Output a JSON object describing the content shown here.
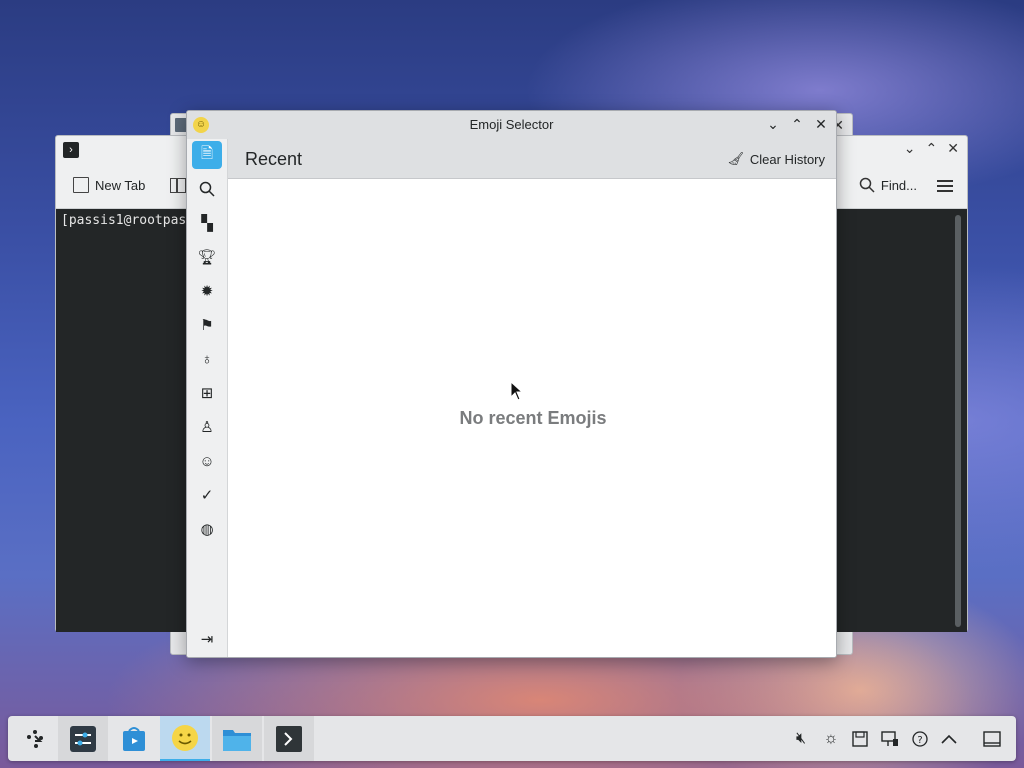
{
  "konsole": {
    "new_tab_label": "New Tab",
    "find_label": "Find...",
    "prompt": "[passis1@rootpas"
  },
  "emoji_selector": {
    "title": "Emoji Selector",
    "header_title": "Recent",
    "clear_history_label": "Clear History",
    "empty_message": "No recent Emojis",
    "sidebar_categories": [
      "recent-icon",
      "search-icon",
      "symbols-icon",
      "activities-icon",
      "objects-icon",
      "flags-icon",
      "food-icon",
      "travel-icon",
      "people-icon",
      "smileys-icon",
      "checkmark-icon",
      "globe-icon"
    ]
  },
  "taskbar": {
    "items": [
      "application-launcher-icon",
      "settings-icon",
      "discover-icon",
      "emoji-selector-icon",
      "file-manager-icon",
      "konsole-icon"
    ],
    "tray": [
      "volume-muted-icon",
      "brightness-icon",
      "save-icon",
      "network-icon",
      "help-icon",
      "show-hidden-icon",
      "show-desktop-icon"
    ]
  },
  "colors": {
    "accent": "#3daee9",
    "titlebar": "#dee0e2",
    "terminal_bg": "#232627"
  }
}
